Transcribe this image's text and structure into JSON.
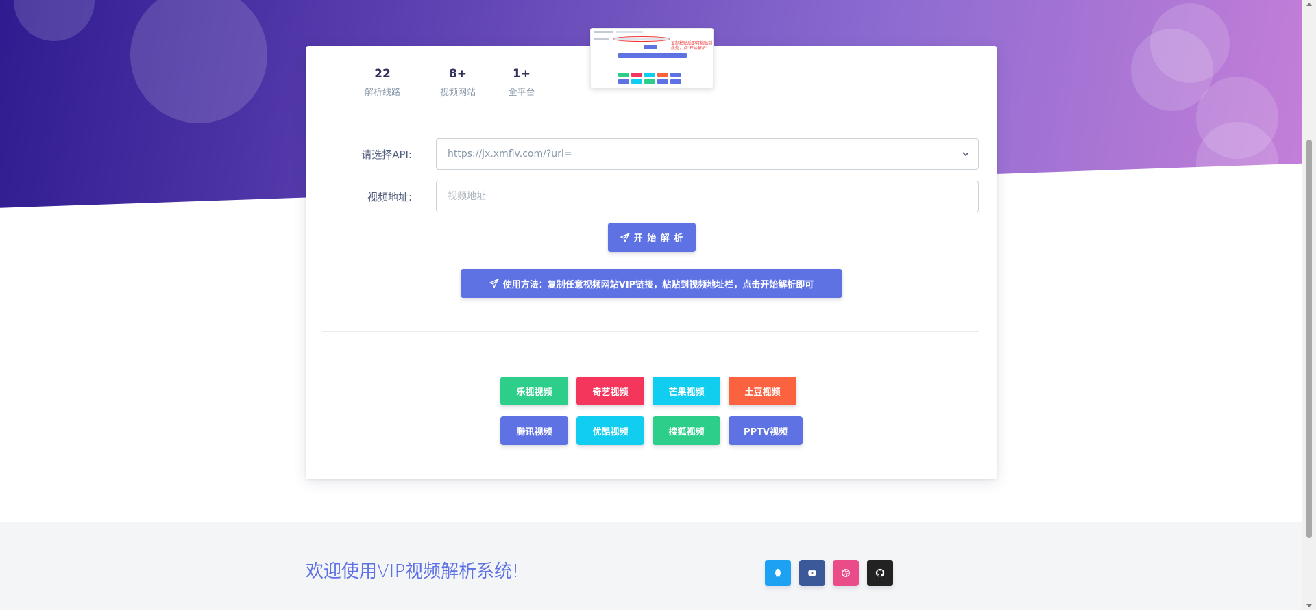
{
  "stats": [
    {
      "value": "22",
      "label": "解析线路"
    },
    {
      "value": "8+",
      "label": "视频网站"
    },
    {
      "value": "1+",
      "label": "全平台"
    }
  ],
  "thumbnail": {
    "note": "复制粘贴后即可粘贴到此处，点\"开始解析\""
  },
  "form": {
    "api_label": "请选择API:",
    "api_selected": "https://jx.xmflv.com/?url=",
    "url_label": "视频地址:",
    "url_placeholder": "视频地址"
  },
  "buttons": {
    "parse_label": "开 始 解 析",
    "usage_label": "使用方法：复制任意视频网站VIP链接，粘贴到视频地址栏，点击开始解析即可"
  },
  "sites": [
    {
      "label": "乐视视频",
      "color": "#2dce89"
    },
    {
      "label": "奇艺视频",
      "color": "#f5365c"
    },
    {
      "label": "芒果视频",
      "color": "#11cdef"
    },
    {
      "label": "土豆视频",
      "color": "#fb6340"
    },
    {
      "label": "腾讯视频",
      "color": "#5e72e4"
    },
    {
      "label": "优酷视频",
      "color": "#11cdef"
    },
    {
      "label": "搜狐视频",
      "color": "#2dce89"
    },
    {
      "label": "PPTV视频",
      "color": "#5e72e4"
    }
  ],
  "footer": {
    "welcome": "欢迎使用VIP视频解析系统!",
    "social": [
      {
        "icon": "qq-icon",
        "color": "#1da1f2"
      },
      {
        "icon": "youtube-icon",
        "color": "#3b5998"
      },
      {
        "icon": "dribbble-icon",
        "color": "#ea4c89"
      },
      {
        "icon": "github-icon",
        "color": "#222222"
      }
    ]
  },
  "colors": {
    "primary": "#5e72e4",
    "hero_start": "#2f1b8f",
    "hero_end": "#c47fd8"
  }
}
